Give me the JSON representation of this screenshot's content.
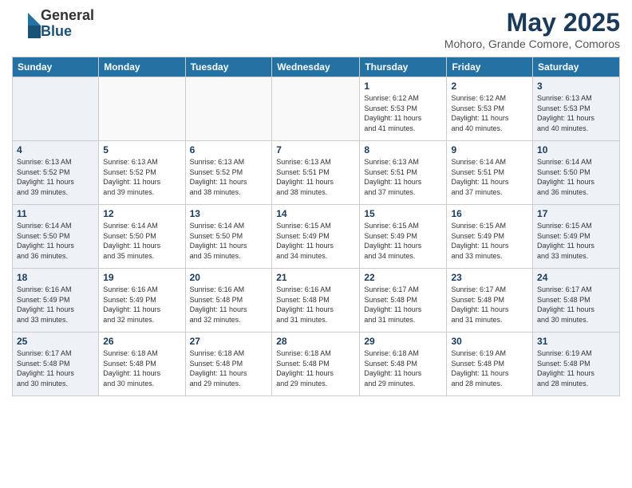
{
  "header": {
    "logo_general": "General",
    "logo_blue": "Blue",
    "month_title": "May 2025",
    "subtitle": "Mohoro, Grande Comore, Comoros"
  },
  "days_of_week": [
    "Sunday",
    "Monday",
    "Tuesday",
    "Wednesday",
    "Thursday",
    "Friday",
    "Saturday"
  ],
  "weeks": [
    [
      {
        "day": "",
        "info": ""
      },
      {
        "day": "",
        "info": ""
      },
      {
        "day": "",
        "info": ""
      },
      {
        "day": "",
        "info": ""
      },
      {
        "day": "1",
        "info": "Sunrise: 6:12 AM\nSunset: 5:53 PM\nDaylight: 11 hours\nand 41 minutes."
      },
      {
        "day": "2",
        "info": "Sunrise: 6:12 AM\nSunset: 5:53 PM\nDaylight: 11 hours\nand 40 minutes."
      },
      {
        "day": "3",
        "info": "Sunrise: 6:13 AM\nSunset: 5:53 PM\nDaylight: 11 hours\nand 40 minutes."
      }
    ],
    [
      {
        "day": "4",
        "info": "Sunrise: 6:13 AM\nSunset: 5:52 PM\nDaylight: 11 hours\nand 39 minutes."
      },
      {
        "day": "5",
        "info": "Sunrise: 6:13 AM\nSunset: 5:52 PM\nDaylight: 11 hours\nand 39 minutes."
      },
      {
        "day": "6",
        "info": "Sunrise: 6:13 AM\nSunset: 5:52 PM\nDaylight: 11 hours\nand 38 minutes."
      },
      {
        "day": "7",
        "info": "Sunrise: 6:13 AM\nSunset: 5:51 PM\nDaylight: 11 hours\nand 38 minutes."
      },
      {
        "day": "8",
        "info": "Sunrise: 6:13 AM\nSunset: 5:51 PM\nDaylight: 11 hours\nand 37 minutes."
      },
      {
        "day": "9",
        "info": "Sunrise: 6:14 AM\nSunset: 5:51 PM\nDaylight: 11 hours\nand 37 minutes."
      },
      {
        "day": "10",
        "info": "Sunrise: 6:14 AM\nSunset: 5:50 PM\nDaylight: 11 hours\nand 36 minutes."
      }
    ],
    [
      {
        "day": "11",
        "info": "Sunrise: 6:14 AM\nSunset: 5:50 PM\nDaylight: 11 hours\nand 36 minutes."
      },
      {
        "day": "12",
        "info": "Sunrise: 6:14 AM\nSunset: 5:50 PM\nDaylight: 11 hours\nand 35 minutes."
      },
      {
        "day": "13",
        "info": "Sunrise: 6:14 AM\nSunset: 5:50 PM\nDaylight: 11 hours\nand 35 minutes."
      },
      {
        "day": "14",
        "info": "Sunrise: 6:15 AM\nSunset: 5:49 PM\nDaylight: 11 hours\nand 34 minutes."
      },
      {
        "day": "15",
        "info": "Sunrise: 6:15 AM\nSunset: 5:49 PM\nDaylight: 11 hours\nand 34 minutes."
      },
      {
        "day": "16",
        "info": "Sunrise: 6:15 AM\nSunset: 5:49 PM\nDaylight: 11 hours\nand 33 minutes."
      },
      {
        "day": "17",
        "info": "Sunrise: 6:15 AM\nSunset: 5:49 PM\nDaylight: 11 hours\nand 33 minutes."
      }
    ],
    [
      {
        "day": "18",
        "info": "Sunrise: 6:16 AM\nSunset: 5:49 PM\nDaylight: 11 hours\nand 33 minutes."
      },
      {
        "day": "19",
        "info": "Sunrise: 6:16 AM\nSunset: 5:49 PM\nDaylight: 11 hours\nand 32 minutes."
      },
      {
        "day": "20",
        "info": "Sunrise: 6:16 AM\nSunset: 5:48 PM\nDaylight: 11 hours\nand 32 minutes."
      },
      {
        "day": "21",
        "info": "Sunrise: 6:16 AM\nSunset: 5:48 PM\nDaylight: 11 hours\nand 31 minutes."
      },
      {
        "day": "22",
        "info": "Sunrise: 6:17 AM\nSunset: 5:48 PM\nDaylight: 11 hours\nand 31 minutes."
      },
      {
        "day": "23",
        "info": "Sunrise: 6:17 AM\nSunset: 5:48 PM\nDaylight: 11 hours\nand 31 minutes."
      },
      {
        "day": "24",
        "info": "Sunrise: 6:17 AM\nSunset: 5:48 PM\nDaylight: 11 hours\nand 30 minutes."
      }
    ],
    [
      {
        "day": "25",
        "info": "Sunrise: 6:17 AM\nSunset: 5:48 PM\nDaylight: 11 hours\nand 30 minutes."
      },
      {
        "day": "26",
        "info": "Sunrise: 6:18 AM\nSunset: 5:48 PM\nDaylight: 11 hours\nand 30 minutes."
      },
      {
        "day": "27",
        "info": "Sunrise: 6:18 AM\nSunset: 5:48 PM\nDaylight: 11 hours\nand 29 minutes."
      },
      {
        "day": "28",
        "info": "Sunrise: 6:18 AM\nSunset: 5:48 PM\nDaylight: 11 hours\nand 29 minutes."
      },
      {
        "day": "29",
        "info": "Sunrise: 6:18 AM\nSunset: 5:48 PM\nDaylight: 11 hours\nand 29 minutes."
      },
      {
        "day": "30",
        "info": "Sunrise: 6:19 AM\nSunset: 5:48 PM\nDaylight: 11 hours\nand 28 minutes."
      },
      {
        "day": "31",
        "info": "Sunrise: 6:19 AM\nSunset: 5:48 PM\nDaylight: 11 hours\nand 28 minutes."
      }
    ]
  ]
}
